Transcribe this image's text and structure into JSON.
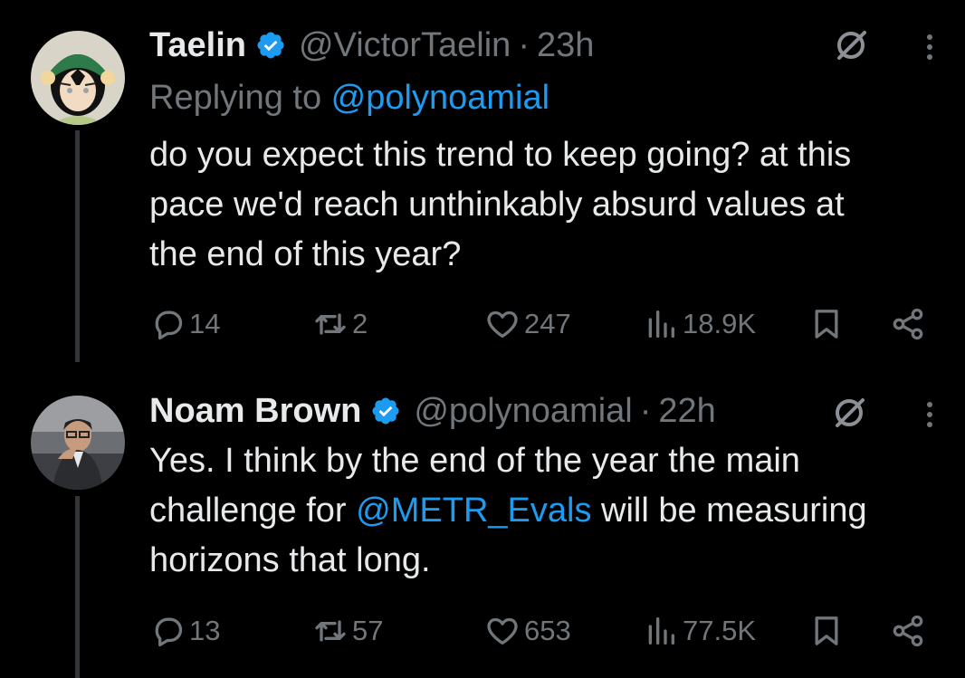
{
  "tweets": [
    {
      "author": {
        "name": "Taelin",
        "handle": "@VictorTaelin",
        "verified": true
      },
      "separator": "·",
      "time": "23h",
      "replying_prefix": "Replying to ",
      "replying_to": "@polynoamial",
      "text_lines": [
        "do you expect this trend to keep going? at this",
        "pace we'd reach unthinkably absurd values at",
        "the end of this year?"
      ],
      "metrics": {
        "replies": "14",
        "reposts": "2",
        "likes": "247",
        "views": "18.9K"
      }
    },
    {
      "author": {
        "name": "Noam Brown",
        "handle": "@polynoamial",
        "verified": true
      },
      "separator": "·",
      "time": "22h",
      "text_line_1": "Yes. I think by the end of the year the main",
      "text_line_2_before": "challenge for ",
      "text_line_2_mention": "@METR_Evals",
      "text_line_2_after": " will be measuring",
      "text_line_3": "horizons that long.",
      "metrics": {
        "replies": "13",
        "reposts": "57",
        "likes": "653",
        "views": "77.5K"
      }
    }
  ],
  "colors": {
    "background": "#000000",
    "text": "#e7e9ea",
    "muted": "#71767b",
    "link": "#1d9bf0",
    "thread_line": "#333639"
  }
}
